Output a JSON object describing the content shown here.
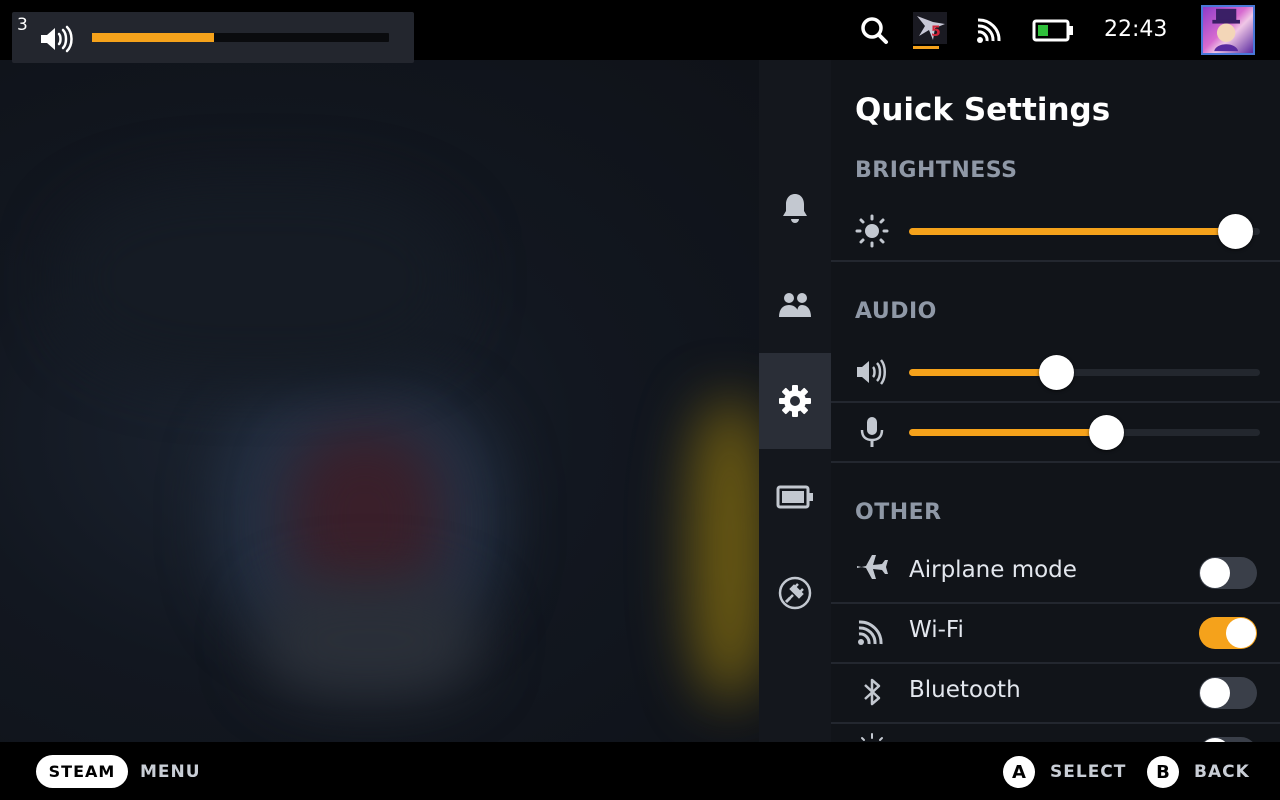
{
  "topbar": {
    "volume_osd": {
      "step": "3",
      "level_fraction": 0.41
    },
    "icons": [
      "search-icon",
      "game-thumbnail-icon",
      "wifi-icon",
      "battery-icon"
    ],
    "battery_color": "#2fbf3a",
    "clock": "22:43"
  },
  "sidenav": {
    "items": [
      {
        "name": "notifications",
        "icon": "bell-icon"
      },
      {
        "name": "friends",
        "icon": "friends-icon"
      },
      {
        "name": "settings",
        "icon": "gear-icon",
        "active": true
      },
      {
        "name": "performance",
        "icon": "battery-icon"
      },
      {
        "name": "power",
        "icon": "plug-icon"
      }
    ]
  },
  "panel": {
    "title": "Quick Settings",
    "brightness": {
      "header": "BRIGHTNESS",
      "level_fraction": 0.93
    },
    "audio": {
      "header": "AUDIO",
      "volume_fraction": 0.42,
      "mic_fraction": 0.56
    },
    "other": {
      "header": "OTHER",
      "toggles": [
        {
          "label": "Airplane mode",
          "icon": "airplane-icon",
          "on": false
        },
        {
          "label": "Wi-Fi",
          "icon": "wifi-icon",
          "on": true
        },
        {
          "label": "Bluetooth",
          "icon": "bluetooth-icon",
          "on": false
        }
      ]
    }
  },
  "bottombar": {
    "steam_label": "STEAM",
    "menu_label": "MENU",
    "a_glyph": "A",
    "select_label": "SELECT",
    "b_glyph": "B",
    "back_label": "BACK"
  },
  "colors": {
    "accent": "#f5a21b",
    "panel": "#111419",
    "muted_header": "#8f98a6"
  }
}
